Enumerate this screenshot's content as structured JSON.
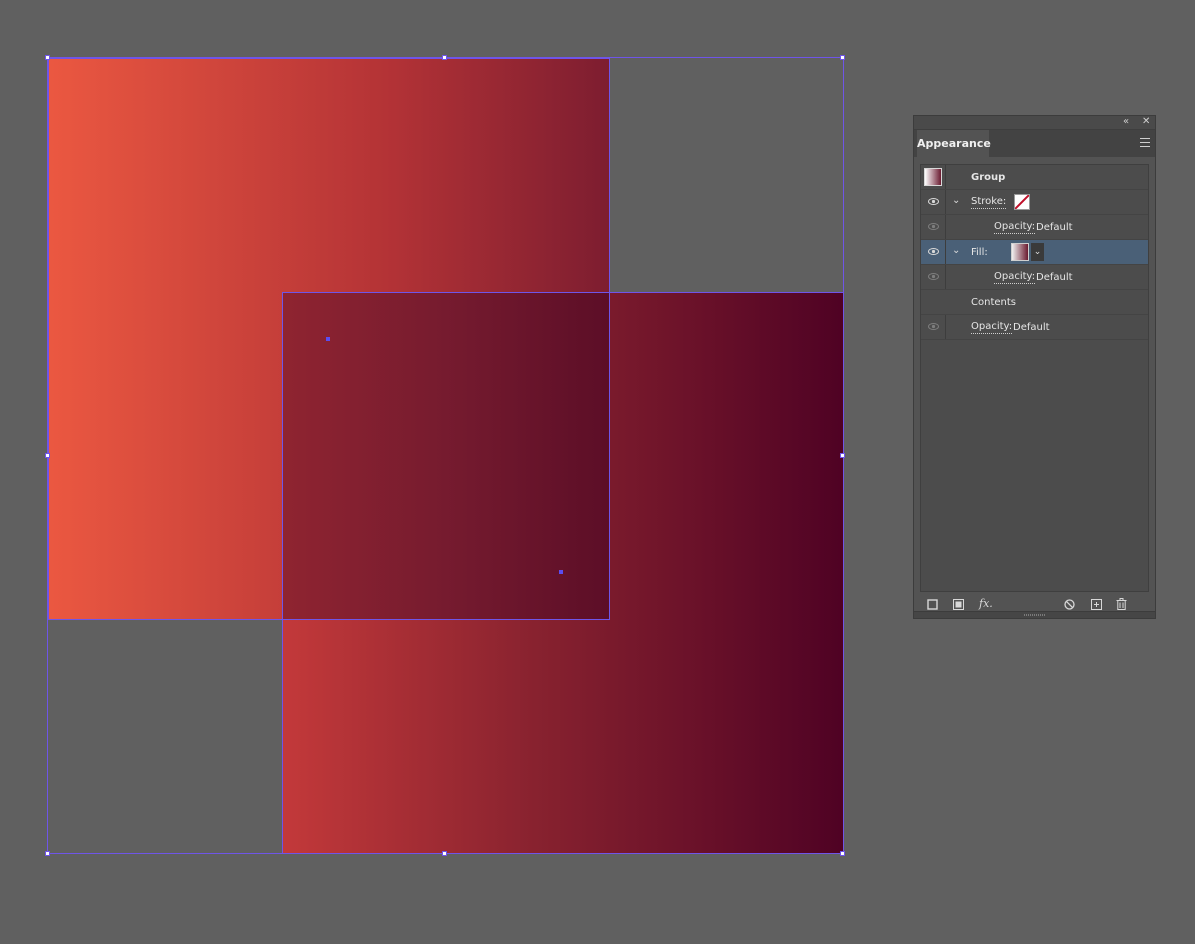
{
  "canvas": {
    "background": "#606060",
    "selection_color": "#6f55e8",
    "rect_a_gradient": [
      "#eb5841",
      "#7d1d30"
    ],
    "rect_b_gradient": [
      "#c3393a",
      "#4f0224"
    ]
  },
  "panel": {
    "tab_label": "Appearance",
    "icons": {
      "collapse": "collapse-arrows-icon",
      "close": "close-icon",
      "menu": "panel-menu-icon"
    },
    "rows": {
      "group": "Group",
      "stroke_label": "Stroke:",
      "stroke_opacity_label": "Opacity:",
      "stroke_opacity_value": "Default",
      "fill_label": "Fill:",
      "fill_opacity_label": "Opacity:",
      "fill_opacity_value": "Default",
      "contents": "Contents",
      "group_opacity_label": "Opacity:",
      "group_opacity_value": "Default"
    },
    "bottom_icons": {
      "fx_label": "fx."
    },
    "selected_row_color": "#4a6077"
  }
}
